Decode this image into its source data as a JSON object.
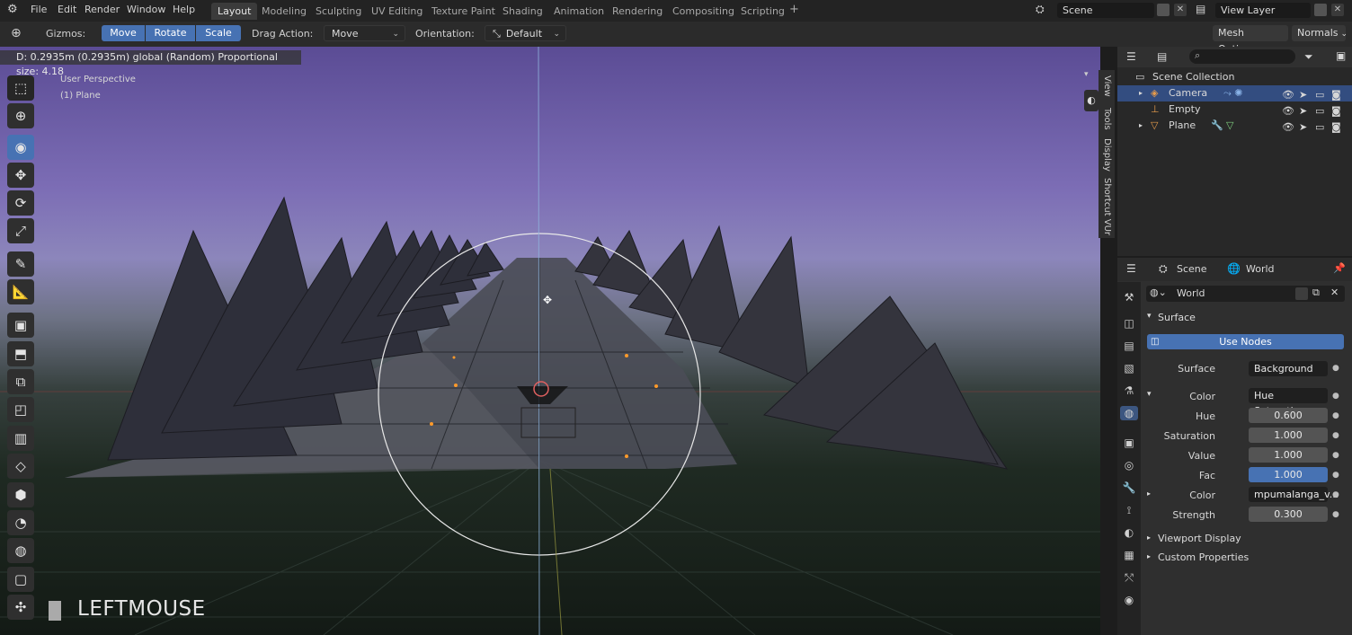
{
  "menu": {
    "file": "File",
    "edit": "Edit",
    "render": "Render",
    "window": "Window",
    "help": "Help"
  },
  "workspaces": [
    "Layout",
    "Modeling",
    "Sculpting",
    "UV Editing",
    "Texture Paint",
    "Shading",
    "Animation",
    "Rendering",
    "Compositing",
    "Scripting"
  ],
  "active_workspace": "Layout",
  "scene_name": "Scene",
  "view_layer": "View Layer",
  "header": {
    "gizmos": "Gizmos:",
    "move": "Move",
    "rotate": "Rotate",
    "scale": "Scale",
    "drag_action": "Drag Action:",
    "drag_value": "Move",
    "orientation": "Orientation:",
    "orientation_value": "Default",
    "mesh_options": "Mesh Options",
    "normals": "Normals"
  },
  "viewport": {
    "status": "D: 0.2935m (0.2935m) global (Random)  Proportional size: 4.18",
    "view_name": "User Perspective",
    "object_name": "(1) Plane",
    "key_overlay": "LEFTMOUSE"
  },
  "npanel_tabs": [
    "View",
    "Tools",
    "Display",
    "Shortcut VUr"
  ],
  "outliner": {
    "root": "Scene Collection",
    "items": [
      {
        "name": "Camera",
        "icon": "camera-icon",
        "selected": true
      },
      {
        "name": "Empty",
        "icon": "empty-icon",
        "selected": false
      },
      {
        "name": "Plane",
        "icon": "mesh-icon",
        "selected": false
      }
    ]
  },
  "properties": {
    "breadcrumb_scene": "Scene",
    "breadcrumb_world": "World",
    "world_name": "World",
    "surface_section": "Surface",
    "use_nodes": "Use Nodes",
    "surface_label": "Surface",
    "surface_value": "Background",
    "color_label": "Color",
    "color_value": "Hue Saturation ...",
    "hue_label": "Hue",
    "hue_value": "0.600",
    "saturation_label": "Saturation",
    "saturation_value": "1.000",
    "value_label": "Value",
    "value_value": "1.000",
    "fac_label": "Fac",
    "fac_value": "1.000",
    "color2_label": "Color",
    "color2_value": "mpumalanga_v...",
    "strength_label": "Strength",
    "strength_value": "0.300",
    "viewport_display": "Viewport Display",
    "custom_properties": "Custom Properties"
  },
  "colors": {
    "accent": "#4772b3",
    "selected_row": "#334d80"
  }
}
